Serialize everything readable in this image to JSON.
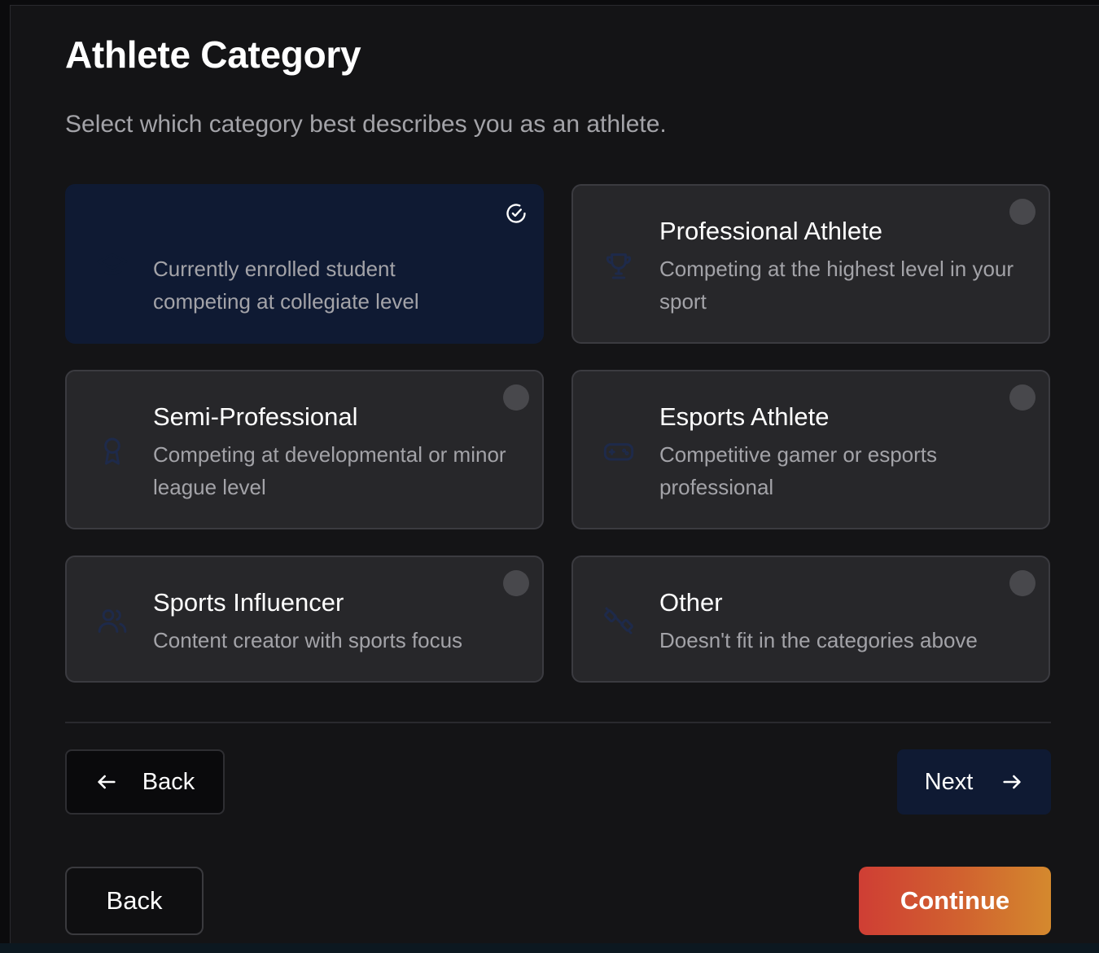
{
  "page": {
    "title": "Athlete Category",
    "subtitle": "Select which category best describes you as an athlete."
  },
  "categories": [
    {
      "title": "",
      "description": "Currently enrolled student competing at collegiate level",
      "icon": "graduation-cap-icon",
      "selected": true
    },
    {
      "title": "Professional Athlete",
      "description": "Competing at the highest level in your sport",
      "icon": "trophy-icon",
      "selected": false
    },
    {
      "title": "Semi-Professional",
      "description": "Competing at developmental or minor league level",
      "icon": "award-ribbon-icon",
      "selected": false
    },
    {
      "title": "Esports Athlete",
      "description": "Competitive gamer or esports professional",
      "icon": "gamepad-icon",
      "selected": false
    },
    {
      "title": "Sports Influencer",
      "description": "Content creator with sports focus",
      "icon": "users-icon",
      "selected": false
    },
    {
      "title": "Other",
      "description": "Doesn't fit in the categories above",
      "icon": "dumbbell-icon",
      "selected": false
    }
  ],
  "nav": {
    "back_label": "Back",
    "next_label": "Next"
  },
  "footer": {
    "back_label": "Back",
    "continue_label": "Continue"
  },
  "colors": {
    "background": "#141416",
    "card": "#27272a",
    "selected_card": "#0f1a33",
    "continue_start": "#cf3e34",
    "continue_end": "#d4892e"
  }
}
